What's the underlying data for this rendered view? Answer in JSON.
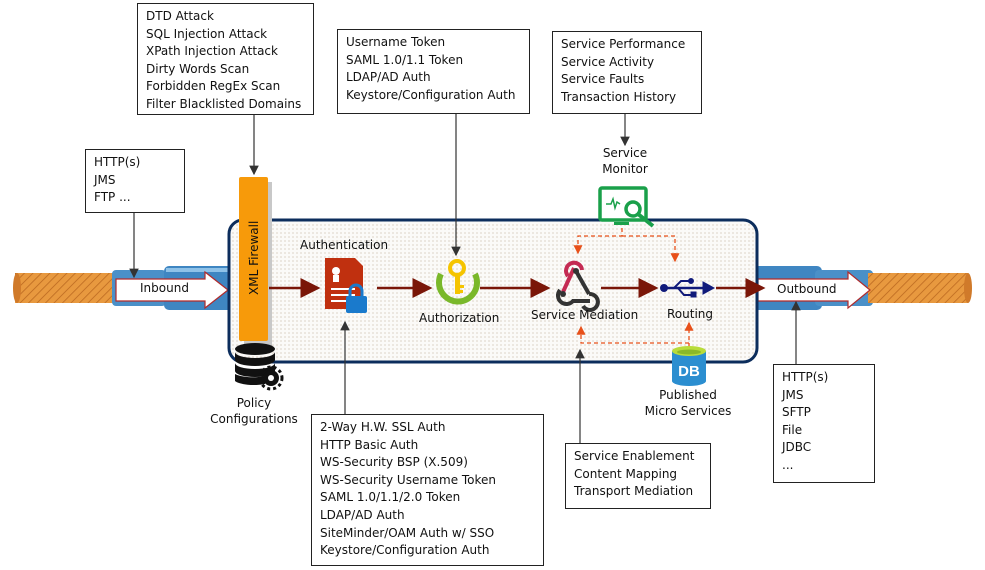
{
  "boxes": {
    "threats": [
      "DTD Attack",
      "SQL Injection Attack",
      "XPath Injection Attack",
      "Dirty Words Scan",
      "Forbidden RegEx Scan",
      "Filter Blacklisted Domains"
    ],
    "inbound_protocols": [
      "HTTP(s)",
      "JMS",
      "FTP ..."
    ],
    "authorization_methods": [
      "Username Token",
      "SAML 1.0/1.1 Token",
      "LDAP/AD Auth",
      "Keystore/Configuration Auth"
    ],
    "monitoring": [
      "Service Performance",
      "Service Activity",
      "Service Faults",
      "Transaction History"
    ],
    "authentication_methods": [
      "2-Way H.W. SSL Auth",
      "HTTP Basic Auth",
      "WS-Security BSP (X.509)",
      "WS-Security Username Token",
      "SAML 1.0/1.1/2.0 Token",
      "LDAP/AD Auth",
      "SiteMinder/OAM Auth w/ SSO",
      "Keystore/Configuration Auth"
    ],
    "mediation_features": [
      "Service Enablement",
      "Content Mapping",
      "Transport Mediation"
    ],
    "outbound_protocols": [
      "HTTP(s)",
      "JMS",
      "SFTP",
      "File",
      "JDBC",
      "..."
    ]
  },
  "labels": {
    "inbound": "Inbound",
    "outbound": "Outbound",
    "firewall": "XML Firewall",
    "authentication": "Authentication",
    "authorization": "Authorization",
    "service_mediation": "Service Mediation",
    "routing": "Routing",
    "service_monitor": [
      "Service",
      "Monitor"
    ],
    "policy_configurations": [
      "Policy",
      "Configurations"
    ],
    "published_micro_services": [
      "Published",
      "Micro Services"
    ],
    "db_icon_text": "DB"
  },
  "colors": {
    "flow": "#7a1608",
    "firewall": "#f79a0a",
    "frame": "#0c2d5c",
    "cable": "#4a90c8",
    "copper": "#e08a3a",
    "monitor": "#1aa04a",
    "dashed": "#e8501a"
  }
}
